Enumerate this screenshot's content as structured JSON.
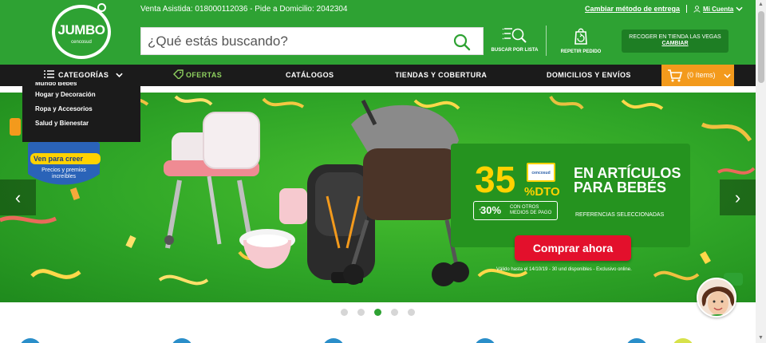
{
  "header": {
    "logo": {
      "name": "JUMBO",
      "sub": "cencosud"
    },
    "contact": "Venta Asistida: 018000112036 - Pide a Domicilio: 2042304",
    "change_delivery": "Cambiar método de entrega",
    "account": "Mi Cuenta",
    "search_placeholder": "¿Qué estás buscando?",
    "search_by_list": "BUSCAR POR LISTA",
    "repeat_order": "REPETIR PEDIDO",
    "pickup_store": "RECOGER EN TIENDA LAS VEGAS",
    "pickup_change": "CAMBIAR",
    "brand_color": "#2ea233"
  },
  "nav": {
    "categories": "CATEGORÍAS",
    "offers": "OFERTAS",
    "catalogs": "CATÁLOGOS",
    "stores": "TIENDAS Y COBERTURA",
    "delivery": "DOMICILIOS Y ENVÍOS",
    "cart": "(0 ítems)"
  },
  "dropdown": {
    "partial": "Mundo Bebés",
    "items": [
      "Hogar y Decoración",
      "Ropa y Accesorios",
      "Salud y Bienestar"
    ]
  },
  "banner": {
    "badge_line1": "Ven para creer",
    "badge_line2": "Precios y premios increíbles",
    "percent": "35",
    "dto": "%DTO",
    "cencosud": "cencosud",
    "headline_1": "EN ARTÍCULOS",
    "headline_2": "PARA BEBÉS",
    "p30_plus": "+",
    "p30": "30%",
    "p30_text_1": "CON OTROS",
    "p30_text_2": "MEDIOS DE PAGO",
    "refs": "REFERENCIAS SELECCIONADAS",
    "buy": "Comprar ahora",
    "legal": "Válido hasta el 14/10/19 - 30 und disponibles - Exclusivo online.",
    "slides_total": 5,
    "active_slide": 3
  }
}
